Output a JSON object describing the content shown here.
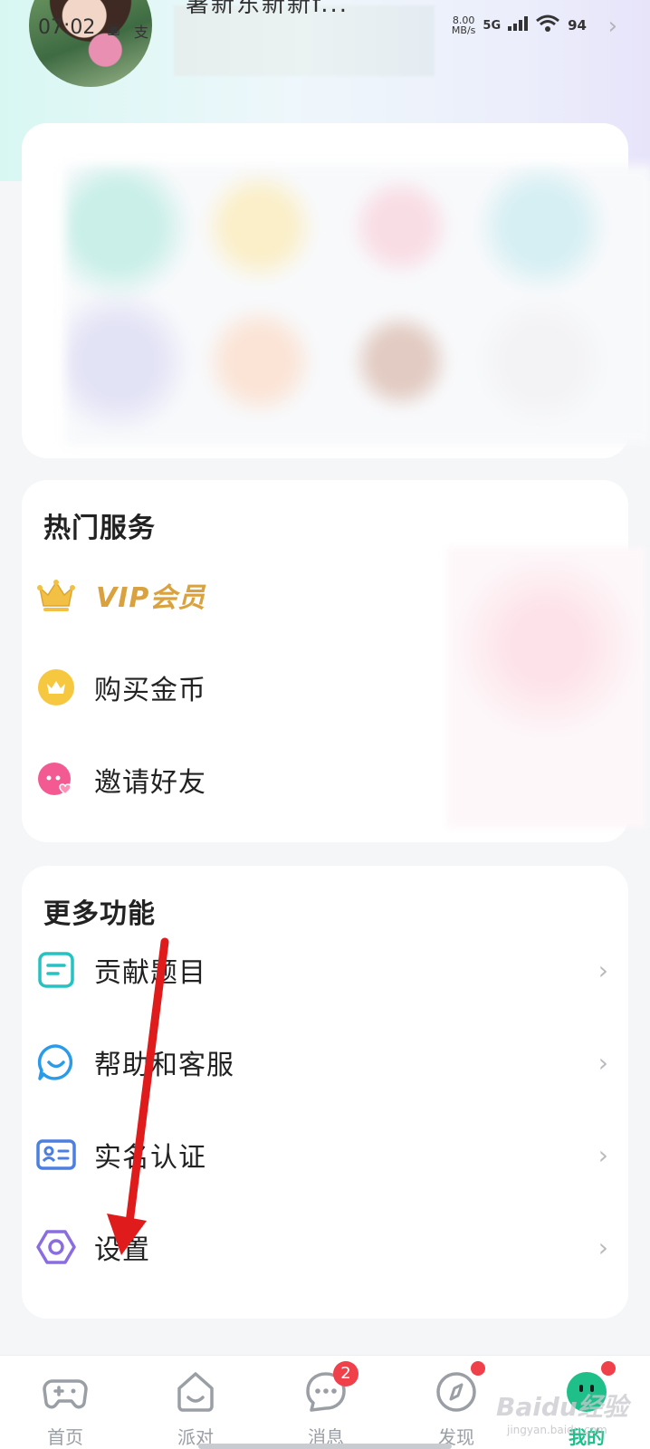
{
  "status_bar": {
    "time": "07:02",
    "speed_value": "8.00",
    "speed_unit": "MB/s",
    "network": "5G",
    "battery": "94"
  },
  "profile": {
    "name_partial": "暑新东新新f..."
  },
  "hot_services": {
    "title": "热门服务",
    "items": [
      {
        "label": "VIP会员",
        "icon": "crown-icon"
      },
      {
        "label": "购买金币",
        "icon": "gold-coin-icon"
      },
      {
        "label": "邀请好友",
        "icon": "invite-friend-icon"
      }
    ]
  },
  "more_functions": {
    "title": "更多功能",
    "items": [
      {
        "label": "贡献题目",
        "icon": "document-icon"
      },
      {
        "label": "帮助和客服",
        "icon": "customer-service-icon"
      },
      {
        "label": "实名认证",
        "icon": "id-card-icon"
      },
      {
        "label": "设置",
        "icon": "hexagon-settings-icon"
      }
    ]
  },
  "tabbar": {
    "tabs": [
      {
        "label": "首页",
        "icon": "gamepad-icon"
      },
      {
        "label": "派对",
        "icon": "party-icon"
      },
      {
        "label": "消息",
        "icon": "message-icon",
        "badge": "2"
      },
      {
        "label": "发现",
        "icon": "compass-icon"
      },
      {
        "label": "我的",
        "icon": "profile-face-icon",
        "active": true
      }
    ]
  },
  "watermark": {
    "text": "Baidu经验",
    "sub": "jingyan.baidu.com"
  },
  "colors": {
    "accent_green": "#1fbf8a",
    "vip_gold": "#d9a23f",
    "badge_red": "#f0404a",
    "arrow_red": "#e01b1b"
  }
}
